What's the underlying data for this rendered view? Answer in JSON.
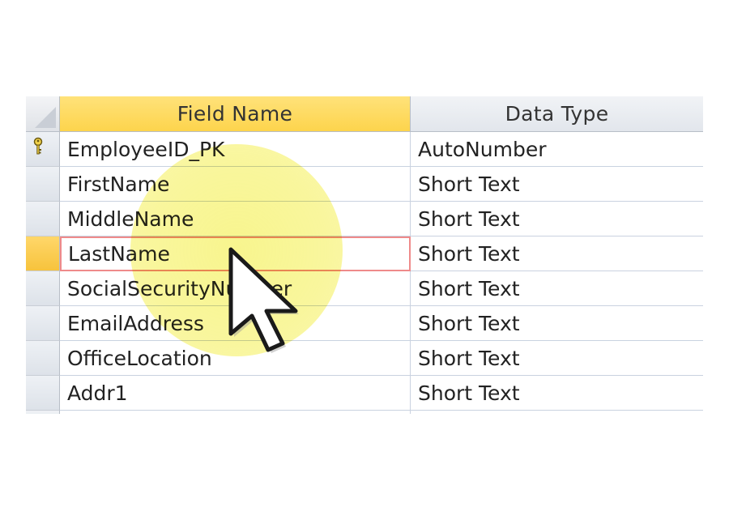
{
  "table": {
    "columns": {
      "field_name": "Field Name",
      "data_type": "Data Type"
    },
    "rows": [
      {
        "field": "EmployeeID_PK",
        "type": "AutoNumber",
        "primary_key": true
      },
      {
        "field": "FirstName",
        "type": "Short Text"
      },
      {
        "field": "MiddleName",
        "type": "Short Text"
      },
      {
        "field": "LastName",
        "type": "Short Text",
        "current": true
      },
      {
        "field": "SocialSecurityNumber",
        "type": "Short Text"
      },
      {
        "field": "EmailAddress",
        "type": "Short Text"
      },
      {
        "field": "OfficeLocation",
        "type": "Short Text"
      },
      {
        "field": "Addr1",
        "type": "Short Text"
      }
    ]
  },
  "icons": {
    "key": "primary-key-icon",
    "cursor": "mouse-pointer-icon"
  },
  "colors": {
    "header_highlight": "#fdd44c",
    "current_row_selector": "#f7c33c",
    "active_cell_border": "#ef8a8a",
    "cursor_spotlight": "#f6f26e"
  }
}
